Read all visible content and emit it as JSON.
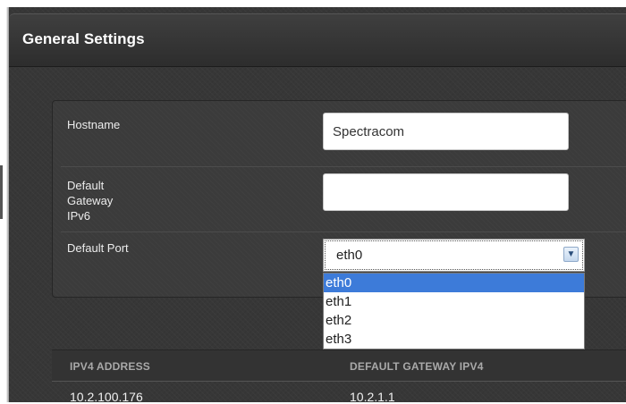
{
  "panel": {
    "title": "General Settings"
  },
  "form": {
    "hostname": {
      "label": "Hostname",
      "value": "Spectracom"
    },
    "default_gateway_ipv6": {
      "label_line1": "Default",
      "label_line2": "Gateway",
      "label_line3": "IPv6",
      "value": ""
    },
    "default_port": {
      "label": "Default Port",
      "selected": "eth0",
      "options": [
        "eth0",
        "eth1",
        "eth2",
        "eth3"
      ]
    }
  },
  "table": {
    "headers": [
      "IPV4 ADDRESS",
      "DEFAULT GATEWAY IPV4"
    ],
    "rows": [
      [
        "10.2.100.176",
        "10.2.1.1"
      ]
    ]
  },
  "icons": {
    "dropdown_arrow": "chevron-down-icon"
  },
  "colors": {
    "panel_bg": "#373737",
    "header_bg": "#2d2d2d",
    "selected_option_bg": "#3d7bd9",
    "label_text": "#ececec",
    "column_header_text": "#a9a9a9"
  }
}
